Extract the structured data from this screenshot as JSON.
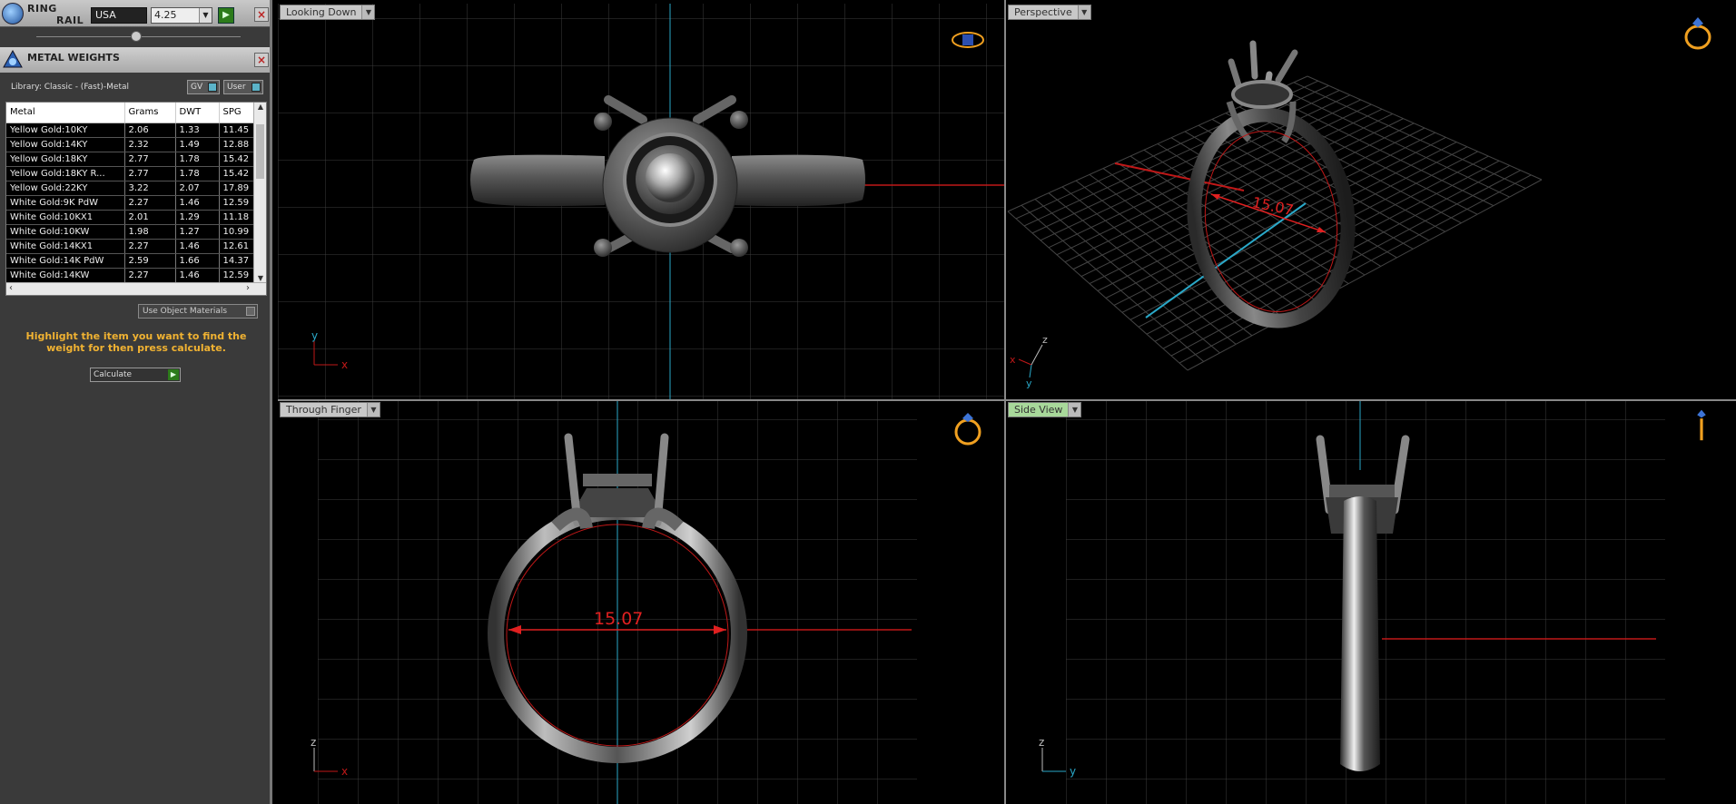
{
  "ring_rail": {
    "title_line1": "RING",
    "title_line2": "RAIL",
    "country": "USA",
    "size": "4.25"
  },
  "metal_weights": {
    "title": "METAL WEIGHTS",
    "library": "Library: Classic - (Fast)-Metal",
    "gv_label": "GV",
    "user_label": "User",
    "columns": [
      "Metal",
      "Grams",
      "DWT",
      "SPG"
    ],
    "rows": [
      [
        "Yellow Gold:10KY",
        "2.06",
        "1.33",
        "11.45"
      ],
      [
        "Yellow Gold:14KY",
        "2.32",
        "1.49",
        "12.88"
      ],
      [
        "Yellow Gold:18KY",
        "2.77",
        "1.78",
        "15.42"
      ],
      [
        "Yellow Gold:18KY R...",
        "2.77",
        "1.78",
        "15.42"
      ],
      [
        "Yellow Gold:22KY",
        "3.22",
        "2.07",
        "17.89"
      ],
      [
        "White Gold:9K PdW",
        "2.27",
        "1.46",
        "12.59"
      ],
      [
        "White Gold:10KX1",
        "2.01",
        "1.29",
        "11.18"
      ],
      [
        "White Gold:10KW",
        "1.98",
        "1.27",
        "10.99"
      ],
      [
        "White Gold:14KX1",
        "2.27",
        "1.46",
        "12.61"
      ],
      [
        "White Gold:14K PdW",
        "2.59",
        "1.66",
        "14.37"
      ],
      [
        "White Gold:14KW",
        "2.27",
        "1.46",
        "12.59"
      ]
    ],
    "use_object_materials": "Use Object Materials",
    "hint": "Highlight the item you want to find the weight for then press calculate.",
    "calculate": "Calculate"
  },
  "viewports": {
    "top": {
      "label": "Looking Down",
      "axis_a": "y",
      "axis_b": "x"
    },
    "perspective": {
      "label": "Perspective",
      "dimension": "15.07",
      "axis_a": "z",
      "axis_b": "x",
      "axis_c": "y"
    },
    "front": {
      "label": "Through Finger",
      "dimension": "15.07",
      "axis_a": "z",
      "axis_b": "x"
    },
    "side": {
      "label": "Side View",
      "axis_a": "z",
      "axis_b": "y"
    }
  },
  "colors": {
    "gold_icon": "#f0a020",
    "dimension_red": "#e02020",
    "axis_cyan": "#2aa8c8",
    "hint_yellow": "#f0b232"
  }
}
